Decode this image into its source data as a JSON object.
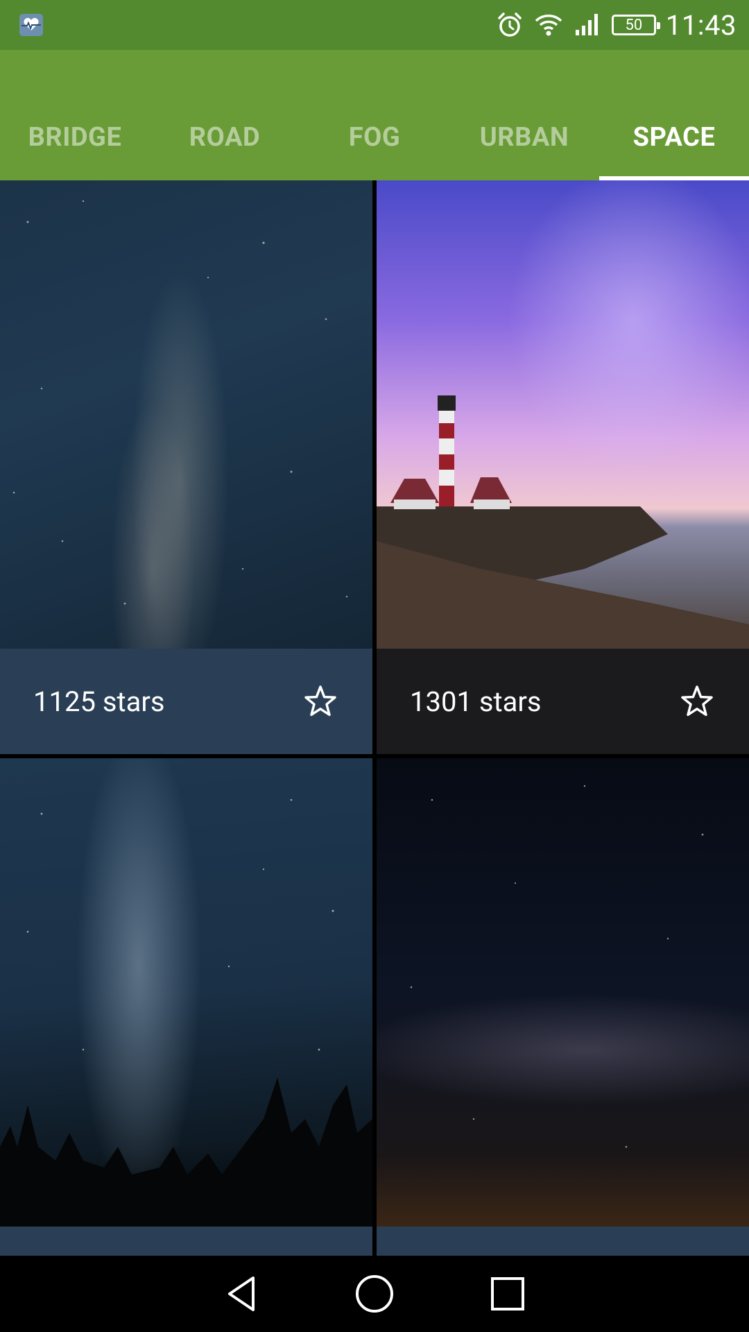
{
  "status_bar": {
    "time": "11:43",
    "battery": "50",
    "icons": [
      "health-app-icon",
      "alarm-icon",
      "wifi-icon",
      "signal-icon",
      "battery-icon"
    ]
  },
  "tabs": [
    {
      "label": "BRIDGE",
      "selected": false
    },
    {
      "label": "ROAD",
      "selected": false
    },
    {
      "label": "FOG",
      "selected": false
    },
    {
      "label": "URBAN",
      "selected": false
    },
    {
      "label": "SPACE",
      "selected": true
    }
  ],
  "cards": [
    {
      "stars_label": "1125 stars",
      "footer_color": "#2a3f55",
      "image": "milky-way-photo"
    },
    {
      "stars_label": "1301 stars",
      "footer_color": "#1b1b1d",
      "image": "lighthouse-photo"
    },
    {
      "stars_label": "",
      "footer_color": "#2a3f55",
      "image": "milky-way-forest-photo"
    },
    {
      "stars_label": "",
      "footer_color": "#2a3f55",
      "image": "milky-way-horizon-photo"
    }
  ],
  "nav_bar": {
    "icons": [
      "back-icon",
      "home-icon",
      "recents-icon"
    ]
  },
  "colors": {
    "status_bar": "#548a2f",
    "app_bar": "#699b36",
    "tab_indicator": "#ffffff"
  }
}
